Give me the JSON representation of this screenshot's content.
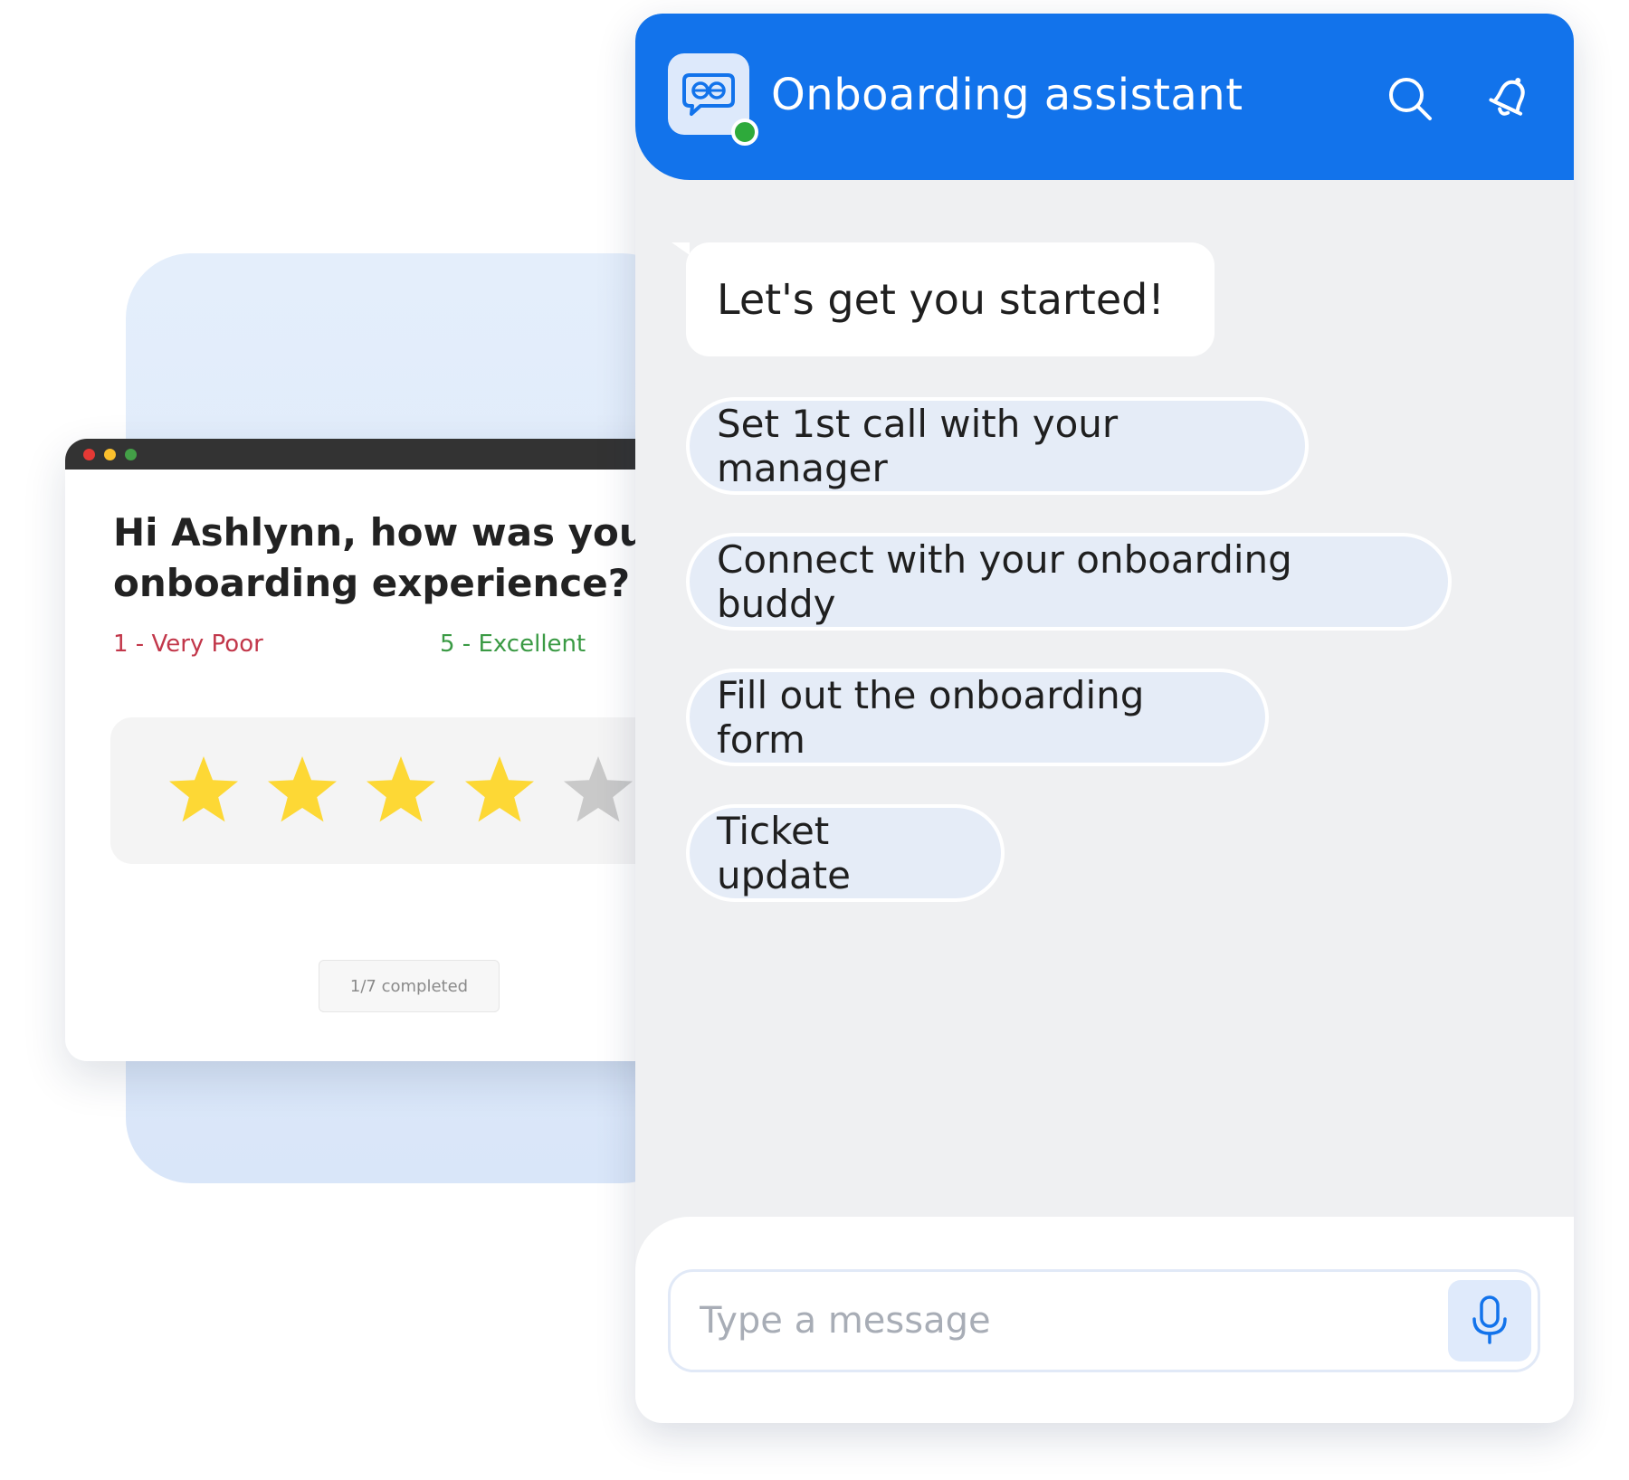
{
  "survey": {
    "question": "Hi Ashlynn, how was your onboarding experience?",
    "scale_low": "1 - Very Poor",
    "scale_high": "5 - Excellent",
    "rating": 4,
    "max_rating": 5,
    "progress": "1/7 completed",
    "window_dots": [
      "red",
      "yellow",
      "green"
    ]
  },
  "chat": {
    "title": "Onboarding assistant",
    "status": "online",
    "icons": [
      "bot-chat-icon",
      "search-icon",
      "bell-icon",
      "microphone-icon"
    ],
    "greeting": "Let's get you started!",
    "quick_replies": [
      "Set 1st call with your manager",
      "Connect with your onboarding buddy",
      "Fill out the onboarding form",
      "Ticket update"
    ],
    "input_placeholder": "Type a message"
  },
  "colors": {
    "brand_blue": "#1273eb",
    "online_green": "#2eaa3b",
    "star_filled": "#fdd835",
    "star_empty": "#c9c9c9",
    "scale_low": "#c2374a",
    "scale_high": "#3a9a44"
  }
}
